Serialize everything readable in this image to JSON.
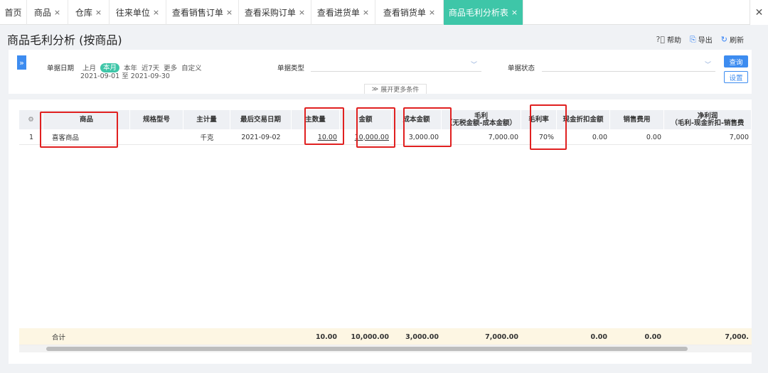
{
  "tabs": [
    {
      "label": "首页",
      "close": "",
      "width": 38
    },
    {
      "label": "商品",
      "close": "×",
      "width": 58
    },
    {
      "label": "仓库",
      "close": "×",
      "width": 58
    },
    {
      "label": "往来单位",
      "close": "×",
      "width": 80
    },
    {
      "label": "查看销售订单",
      "close": "×",
      "width": 102
    },
    {
      "label": "查看采购订单",
      "close": "×",
      "width": 102
    },
    {
      "label": "查看进货单",
      "close": "×",
      "width": 90
    },
    {
      "label": "查看销货单",
      "close": "×",
      "width": 96
    },
    {
      "label": "商品毛利分析表",
      "close": "×",
      "width": 112,
      "active": true
    }
  ],
  "tab_close_all": "✕",
  "page_title": "商品毛利分析 (按商品)",
  "actions": {
    "help": "帮助",
    "export": "导出",
    "refresh": "刷新"
  },
  "filter": {
    "expand_icon": "»",
    "date_label": "单据日期",
    "date_options": [
      "上月",
      "本月",
      "本年",
      "近7天",
      "更多",
      "自定义"
    ],
    "date_current": "本月",
    "date_range": "2021-09-01 至 2021-09-30",
    "doc_type_label": "单据类型",
    "doc_status_label": "单据状态",
    "more_conditions": "展开更多条件",
    "query_button": "查询",
    "settings_button": "设置"
  },
  "table": {
    "settings_icon": "⚙",
    "columns": [
      {
        "key": "idx",
        "label": "",
        "width": 34
      },
      {
        "key": "product",
        "label": "商品",
        "width": 122
      },
      {
        "key": "spec",
        "label": "规格型号",
        "width": 75
      },
      {
        "key": "unit",
        "label": "主计量",
        "width": 66
      },
      {
        "key": "last_date",
        "label": "最后交易日期",
        "width": 86
      },
      {
        "key": "qty",
        "label": "主数量",
        "width": 68
      },
      {
        "key": "amount",
        "label": "金额",
        "width": 73
      },
      {
        "key": "cost",
        "label": "成本金额",
        "width": 70
      },
      {
        "key": "gross",
        "label": "毛利",
        "label2": "（无税金额-成本金额）",
        "width": 112
      },
      {
        "key": "margin",
        "label": "毛利率",
        "width": 50
      },
      {
        "key": "cash_discount",
        "label": "现金折扣金额",
        "width": 75
      },
      {
        "key": "sales_expense",
        "label": "销售费用",
        "width": 76
      },
      {
        "key": "net",
        "label": "净利润",
        "label2": "（毛利-现金折扣-销售费",
        "width": 123
      }
    ],
    "rows": [
      {
        "idx": "1",
        "product": "喜客商品",
        "spec": "",
        "unit": "千克",
        "last_date": "2021-09-02",
        "qty": "10.00",
        "amount": "10,000.00",
        "cost": "3,000.00",
        "gross": "7,000.00",
        "margin": "70%",
        "cash_discount": "0.00",
        "sales_expense": "0.00",
        "net": "7,000"
      }
    ],
    "summary": {
      "label": "合计",
      "qty": "10.00",
      "amount": "10,000.00",
      "cost": "3,000.00",
      "gross": "7,000.00",
      "cash_discount": "0.00",
      "sales_expense": "0.00",
      "net": "7,000."
    }
  },
  "colors": {
    "accent": "#3ec6a8",
    "primary": "#3d8cf0",
    "highlight": "#e02020"
  }
}
